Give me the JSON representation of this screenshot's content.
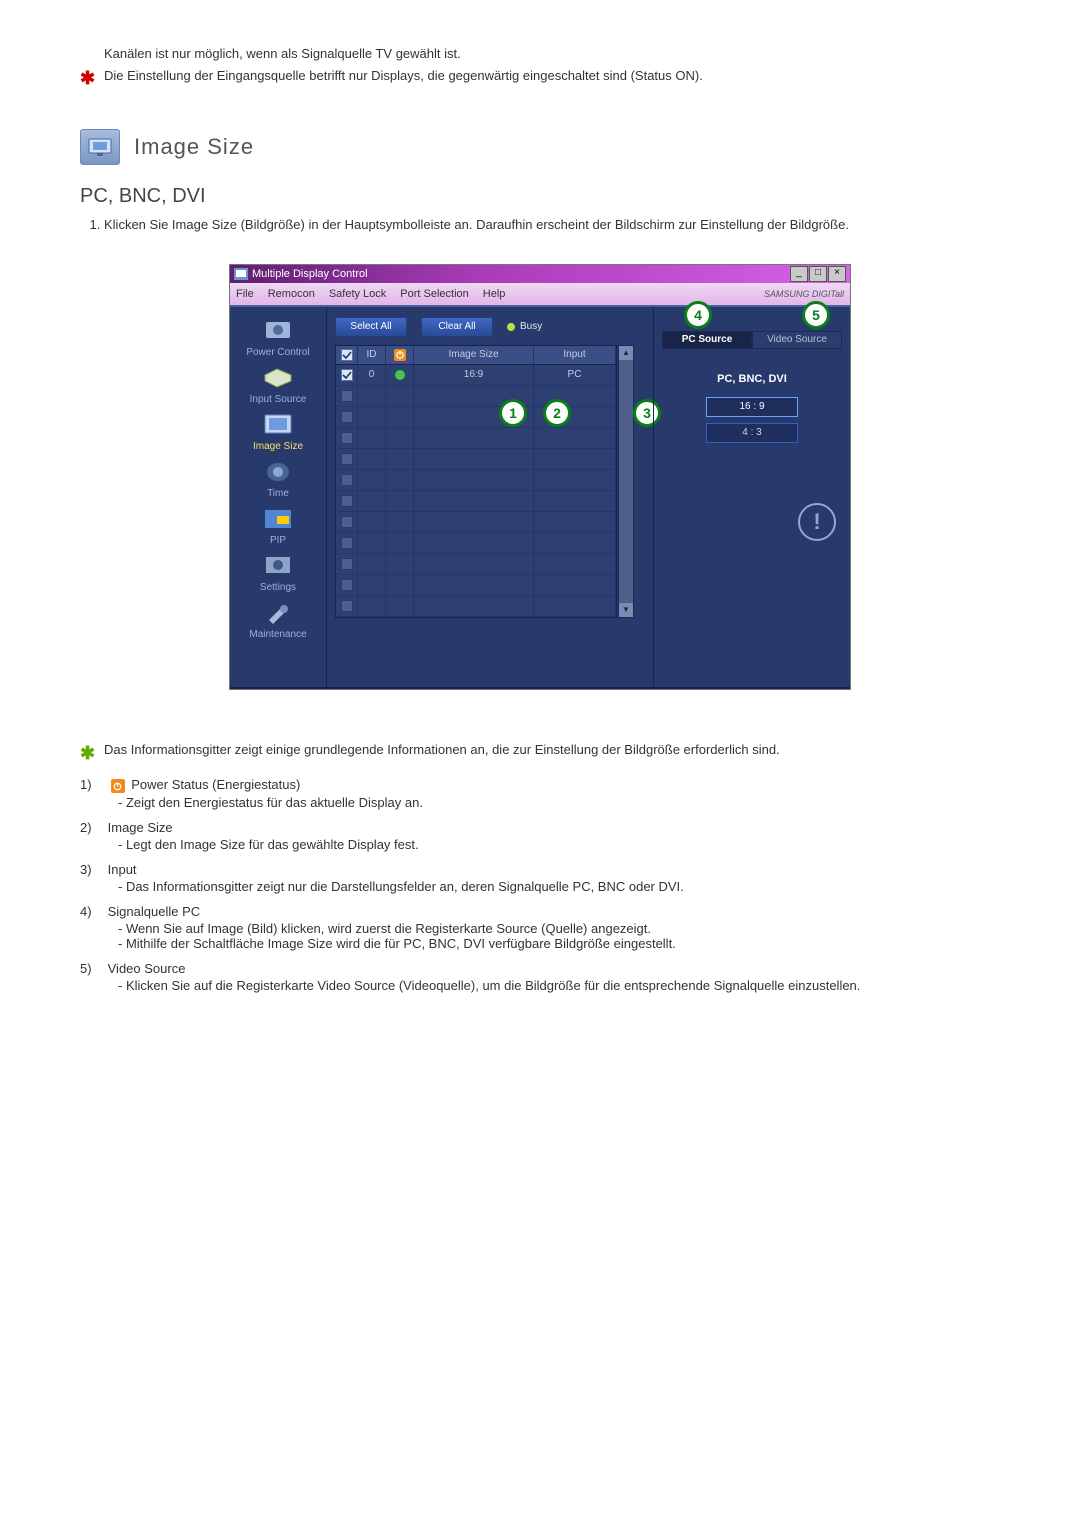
{
  "intro": {
    "line1": "Kanälen ist nur möglich, wenn als Signalquelle TV gewählt ist.",
    "line2": "Die Einstellung der Eingangsquelle betrifft nur Displays, die gegenwärtig eingeschaltet sind (Status ON)."
  },
  "section_title": "Image Size",
  "subsection_title": "PC, BNC, DVI",
  "ol1": "Klicken Sie Image Size (Bildgröße) in der Hauptsymbolleiste an. Daraufhin erscheint der Bildschirm zur Einstellung der Bildgröße.",
  "mdc": {
    "window_title": "Multiple Display Control",
    "menu": {
      "file": "File",
      "remocon": "Remocon",
      "safety": "Safety Lock",
      "port": "Port Selection",
      "help": "Help"
    },
    "brand": "SAMSUNG DIGITall",
    "sidebar": {
      "power": "Power Control",
      "input": "Input Source",
      "image": "Image Size",
      "time": "Time",
      "pip": "PIP",
      "settings": "Settings",
      "maint": "Maintenance"
    },
    "select_all": "Select All",
    "clear_all": "Clear All",
    "busy": "Busy",
    "grid": {
      "hdr_id": "ID",
      "hdr_imgsize": "Image Size",
      "hdr_input": "Input",
      "row0": {
        "id": "0",
        "imgsize": "16:9",
        "input": "PC"
      }
    },
    "tabs": {
      "pc": "PC Source",
      "video": "Video Source"
    },
    "panel_label": "PC, BNC, DVI",
    "ratio_169": "16 : 9",
    "ratio_43": "4 : 3",
    "callouts": {
      "c1": "1",
      "c2": "2",
      "c3": "3",
      "c4": "4",
      "c5": "5"
    }
  },
  "desc": {
    "intro": "Das Informationsgitter zeigt einige grundlegende Informationen an, die zur Einstellung der Bildgröße erforderlich sind.",
    "i1_title": "Power Status (Energiestatus)",
    "i1_sub": "- Zeigt den Energiestatus für das aktuelle Display an.",
    "i2_title": "Image Size",
    "i2_sub": "- Legt den Image Size für das gewählte Display fest.",
    "i3_title": "Input",
    "i3_sub": "- Das Informationsgitter zeigt nur die Darstellungsfelder an, deren Signalquelle PC, BNC oder DVI.",
    "i4_title": "Signalquelle PC",
    "i4_sub1": "- Wenn Sie auf Image (Bild) klicken, wird zuerst die Registerkarte Source (Quelle) angezeigt.",
    "i4_sub2": "- Mithilfe der Schaltfläche Image Size wird die für PC, BNC, DVI verfügbare Bildgröße eingestellt.",
    "i5_title": "Video Source",
    "i5_sub": "- Klicken Sie auf die Registerkarte Video Source (Videoquelle), um die Bildgröße für die entsprechende Signalquelle einzustellen.",
    "n1": "1)",
    "n2": "2)",
    "n3": "3)",
    "n4": "4)",
    "n5": "5)"
  }
}
